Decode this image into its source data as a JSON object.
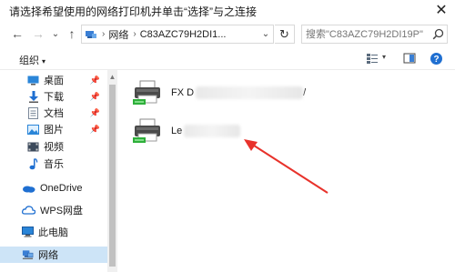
{
  "window": {
    "title": "请选择希望使用的网络打印机并单击“选择”与之连接",
    "close_glyph": "✕"
  },
  "nav": {
    "back_glyph": "←",
    "forward_glyph": "→",
    "recent_glyph": "⌄",
    "up_glyph": "↑",
    "refresh_glyph": "↻",
    "dropdown_glyph": "⌄"
  },
  "address": {
    "separator": "›",
    "segments": [
      "网络",
      "C83AZC79H2DI1..."
    ]
  },
  "search": {
    "placeholder": "搜索\"C83AZC79H2DI19P\""
  },
  "toolbar": {
    "organize_label": "组织",
    "organize_caret": "▾",
    "view_caret": "▾"
  },
  "sidebar": {
    "items": [
      {
        "label": "桌面",
        "icon": "desktop-icon",
        "pinned": true
      },
      {
        "label": "下载",
        "icon": "download-icon",
        "pinned": true
      },
      {
        "label": "文档",
        "icon": "documents-icon",
        "pinned": true
      },
      {
        "label": "图片",
        "icon": "pictures-icon",
        "pinned": true
      },
      {
        "label": "视频",
        "icon": "videos-icon",
        "pinned": false
      },
      {
        "label": "音乐",
        "icon": "music-icon",
        "pinned": false
      },
      {
        "label": "OneDrive",
        "icon": "onedrive-icon",
        "pinned": false
      },
      {
        "label": "WPS网盘",
        "icon": "wps-cloud-icon",
        "pinned": false
      },
      {
        "label": "此电脑",
        "icon": "this-pc-icon",
        "pinned": false
      },
      {
        "label": "网络",
        "icon": "network-icon",
        "pinned": false,
        "selected": true
      }
    ],
    "pin_glyph": "📌",
    "scroll_up_glyph": "▲"
  },
  "printers": [
    {
      "label_visible": "FX D",
      "label_tail": "/"
    },
    {
      "label_visible": "Le",
      "label_tail": ""
    }
  ],
  "colors": {
    "selected_bg": "#cde4f7",
    "annotation_arrow": "#e8322b",
    "printer_green": "#2eaf3a"
  }
}
